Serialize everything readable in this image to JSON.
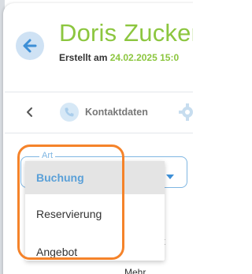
{
  "header": {
    "title": "Doris Zucker",
    "created_prefix": "Erstellt am ",
    "created_date": "24.02.2025 15:0"
  },
  "tabs": {
    "contact_label": "Kontaktdaten"
  },
  "art_select": {
    "legend": "Art",
    "options": [
      "Buchung",
      "Reservierung",
      "Angebot"
    ],
    "selected": "Buchung"
  },
  "background": {
    "partial_t": "t",
    "partial_mehr": "Mehr"
  },
  "colors": {
    "title_green": "#8cc63f",
    "accent_blue": "#7fb6e2",
    "highlight_orange": "#f5832a"
  }
}
